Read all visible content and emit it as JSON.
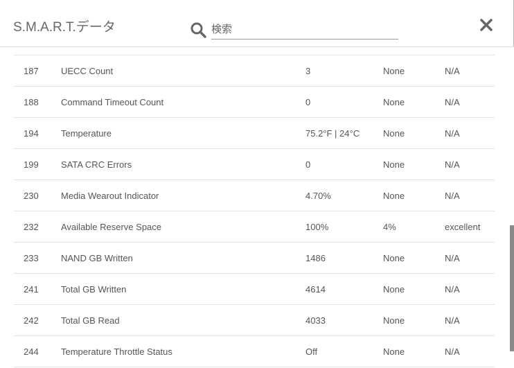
{
  "header": {
    "title": "S.M.A.R.T.データ",
    "search_placeholder": "検索",
    "search_icon": "search-icon",
    "close_icon": "close-icon"
  },
  "rows": [
    {
      "id": "187",
      "name": "UECC Count",
      "value": "3",
      "threshold": "None",
      "status": "N/A"
    },
    {
      "id": "188",
      "name": "Command Timeout Count",
      "value": "0",
      "threshold": "None",
      "status": "N/A"
    },
    {
      "id": "194",
      "name": "Temperature",
      "value": "75.2°F | 24°C",
      "threshold": "None",
      "status": "N/A"
    },
    {
      "id": "199",
      "name": "SATA CRC Errors",
      "value": "0",
      "threshold": "None",
      "status": "N/A"
    },
    {
      "id": "230",
      "name": "Media Wearout Indicator",
      "value": "4.70%",
      "threshold": "None",
      "status": "N/A"
    },
    {
      "id": "232",
      "name": "Available Reserve Space",
      "value": "100%",
      "threshold": "4%",
      "status": "excellent"
    },
    {
      "id": "233",
      "name": "NAND GB Written",
      "value": "1486",
      "threshold": "None",
      "status": "N/A"
    },
    {
      "id": "241",
      "name": "Total GB Written",
      "value": "4614",
      "threshold": "None",
      "status": "N/A"
    },
    {
      "id": "242",
      "name": "Total GB Read",
      "value": "4033",
      "threshold": "None",
      "status": "N/A"
    },
    {
      "id": "244",
      "name": "Temperature Throttle Status",
      "value": "Off",
      "threshold": "None",
      "status": "N/A"
    }
  ]
}
